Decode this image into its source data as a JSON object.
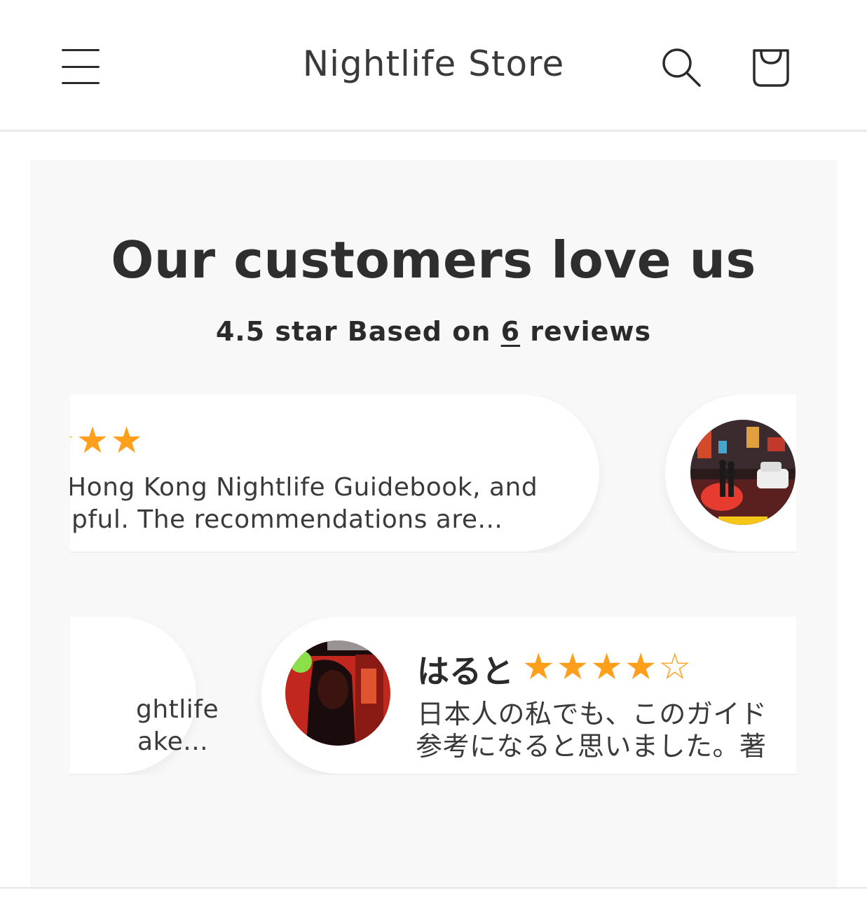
{
  "header": {
    "store_name": "Nightlife Store",
    "menu_icon": "hamburger-menu-icon",
    "search_icon": "search-icon",
    "cart_icon": "shopping-bag-icon"
  },
  "reviews_section": {
    "title": "Our customers love us",
    "summary_prefix": "4.5 star Based on ",
    "review_count": "6",
    "summary_suffix": " reviews",
    "star_color": "#ff9f1c",
    "row1": {
      "card_partial": {
        "stars": "★★★",
        "line1": "Hong Kong Nightlife Guidebook, and",
        "line2": "pful. The recommendations are..."
      }
    },
    "row2": {
      "card_partial": {
        "line1": "ghtlife",
        "line2": "ake..."
      },
      "card_main": {
        "name": "はると",
        "stars": "★★★★",
        "stars_empty": "☆",
        "rating": 4,
        "line1": "日本人の私でも、このガイド",
        "line2": "参考になると思いました。著"
      }
    }
  }
}
